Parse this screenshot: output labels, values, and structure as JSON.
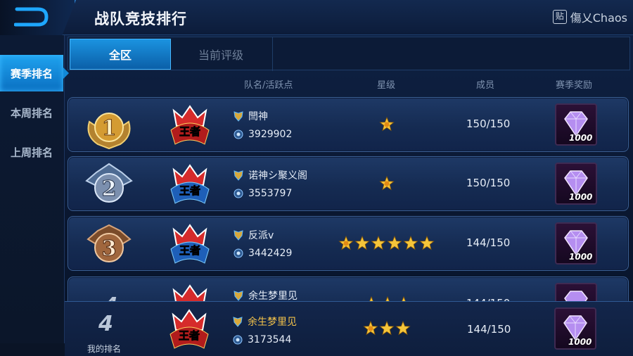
{
  "header": {
    "title": "战队竞技排行",
    "back_icon": "back-arrow-icon"
  },
  "watermark": {
    "icon_text": "贴",
    "text": "傷乂Chaos"
  },
  "sidebar": {
    "items": [
      {
        "label": "赛季排名",
        "active": true
      },
      {
        "label": "本周排名",
        "active": false
      },
      {
        "label": "上周排名",
        "active": false
      }
    ]
  },
  "tabs": [
    {
      "label": "全区",
      "active": true
    },
    {
      "label": "当前评级",
      "active": false
    }
  ],
  "columns": {
    "team": "队名/活跃点",
    "stars": "星级",
    "members": "成员",
    "reward": "赛季奖励"
  },
  "rows": [
    {
      "rank": "1",
      "tier": "最强王者",
      "tier_text": "王者",
      "team": "閆神",
      "points": "3929902",
      "stars": 1,
      "members": "150/150",
      "reward": "1000"
    },
    {
      "rank": "2",
      "tier": "王者",
      "tier_text": "王者",
      "team": "诺神シ聚义阁",
      "points": "3553797",
      "stars": 1,
      "members": "150/150",
      "reward": "1000"
    },
    {
      "rank": "3",
      "tier": "王者",
      "tier_text": "王者",
      "team": "反派v",
      "points": "3442429",
      "stars": 6,
      "members": "144/150",
      "reward": "1000"
    },
    {
      "rank": "4",
      "tier": "最强王者",
      "tier_text": "王者",
      "team": "余生梦里见",
      "points": "",
      "stars": 3,
      "members": "144/150",
      "reward": "1000"
    }
  ],
  "my_rank": {
    "rank": "4",
    "label": "我的排名",
    "team": "余生梦里见",
    "points": "3173544",
    "stars": 3,
    "members": "144/150",
    "reward": "1000"
  },
  "colors": {
    "accent": "#1b93e0",
    "gold": "#f3c24a",
    "row_bg": "#1e3966"
  }
}
